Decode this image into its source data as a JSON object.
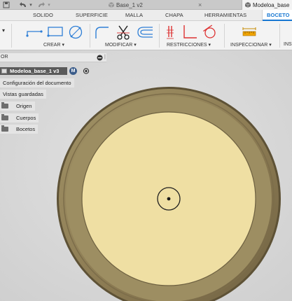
{
  "window": {
    "doc_tabs": [
      {
        "label": "Base_1 v2",
        "active": false
      },
      {
        "label": "Modeloa_base",
        "active": true
      }
    ]
  },
  "workspace_tabs": [
    {
      "label": "SOLIDO",
      "active": false
    },
    {
      "label": "SUPERFICIE",
      "active": false
    },
    {
      "label": "MALLA",
      "active": false
    },
    {
      "label": "CHAPA",
      "active": false
    },
    {
      "label": "HERRAMIENTAS",
      "active": false
    },
    {
      "label": "BOCETO",
      "active": true
    }
  ],
  "ribbon": {
    "groups": [
      {
        "label": "CREAR ▾"
      },
      {
        "label": "MODIFICAR ▾"
      },
      {
        "label": "RESTRICCIONES ▾"
      },
      {
        "label": "INSPECCIONAR ▾"
      },
      {
        "label": "INS"
      }
    ],
    "left_dropdown": "▾"
  },
  "browser": {
    "title": "OR",
    "collapse_icon": "circle-minus-icon",
    "root": {
      "label": "Modeloa_base_1 v3",
      "badge": "M"
    },
    "items": [
      {
        "label": "Configuración del documento",
        "icon": ""
      },
      {
        "label": "Vistas guardadas",
        "icon": ""
      },
      {
        "label": "Origen",
        "icon": "folder-icon"
      },
      {
        "label": "Cuerpos",
        "icon": "folder-icon"
      },
      {
        "label": "Bocetos",
        "icon": "folder-icon"
      }
    ]
  },
  "colors": {
    "outer_ring": "#8d7c55",
    "inner_face": "#eedc9f",
    "accent": "#1677d2",
    "canvas_bg": "#d9d9d9"
  }
}
